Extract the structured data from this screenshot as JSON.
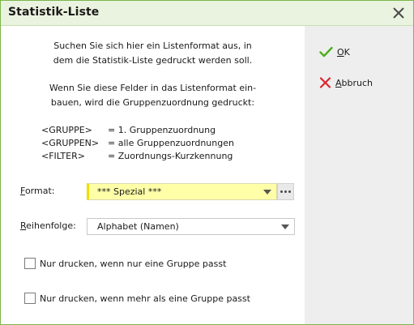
{
  "window": {
    "title": "Statistik-Liste"
  },
  "intro": {
    "line1": "Suchen Sie sich hier ein Listenformat aus, in",
    "line2": "dem die Statistik-Liste gedruckt werden soll.",
    "line3": "Wenn Sie diese Felder in das Listenformat ein-",
    "line4": "bauen, wird die Gruppenzuordnung gedruckt:"
  },
  "placeholders": [
    {
      "key": "<GRUPPE>",
      "value": "= 1. Gruppenzuordnung"
    },
    {
      "key": "<GRUPPEN>",
      "value": "= alle Gruppenzuordnungen"
    },
    {
      "key": "<FILTER>",
      "value": "= Zuordnungs-Kurzkennung"
    }
  ],
  "format": {
    "label_first": "F",
    "label_rest": "ormat:",
    "value": "*** Spezial ***"
  },
  "order": {
    "label_first": "R",
    "label_rest": "eihenfolge:",
    "value": "Alphabet (Namen)"
  },
  "options": {
    "only_one_group": "Nur drucken, wenn nur eine Gruppe passt",
    "more_than_one_group": "Nur drucken, wenn mehr als eine Gruppe passt"
  },
  "actions": {
    "ok_first": "O",
    "ok_rest": "K",
    "cancel_first": "A",
    "cancel_rest": "bbruch"
  },
  "colors": {
    "accent_green": "#4caf1e",
    "cancel_red": "#d9262c",
    "highlight_yellow": "#ffffa8"
  }
}
